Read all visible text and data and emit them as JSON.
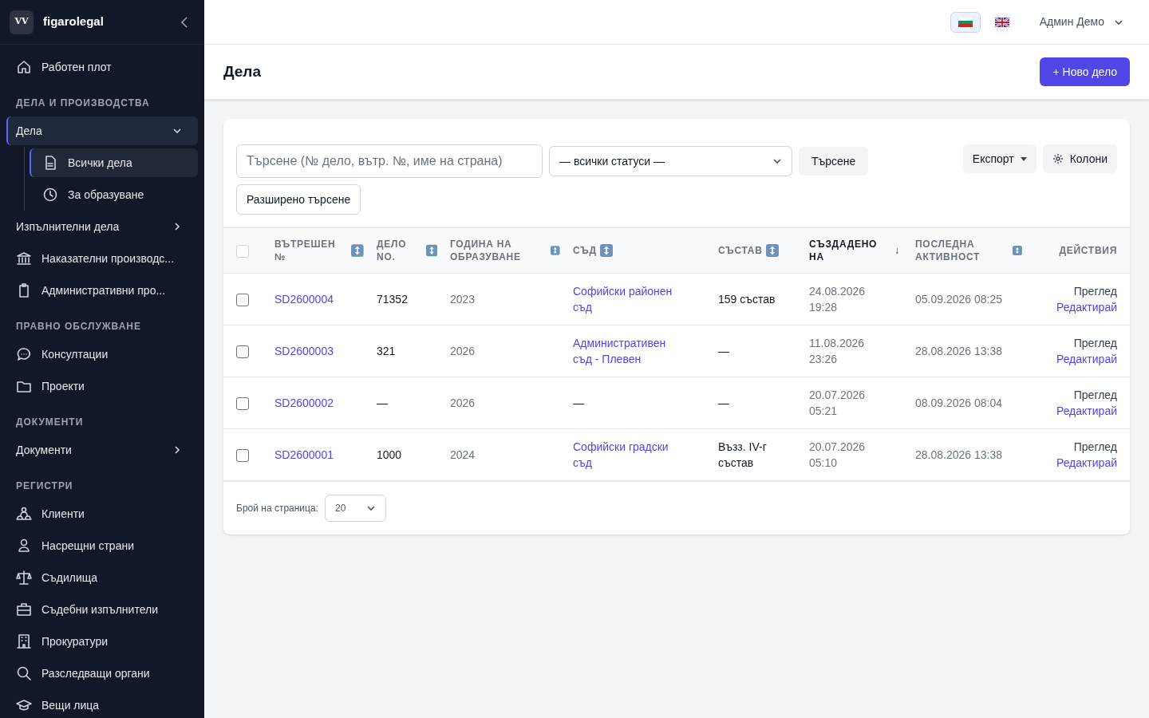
{
  "sidebar": {
    "brand": "figarolegal",
    "logo_text": "VV",
    "sections": [
      {
        "items": [
          {
            "label": "Работен плот",
            "kind": "link",
            "selected": false
          }
        ]
      },
      {
        "heading": "ДЕЛА И ПРОИЗВОДСТВА",
        "items": [
          {
            "label": "Дела",
            "kind": "group",
            "expanded": true,
            "selected": true,
            "children": [
              {
                "label": "Всички дела",
                "selected": true
              },
              {
                "label": "За образуване",
                "selected": false
              }
            ]
          },
          {
            "label": "Изпълнителни дела",
            "kind": "group",
            "expanded": false,
            "selected": false
          },
          {
            "label": "Наказателни производс...",
            "kind": "link",
            "selected": false
          },
          {
            "label": "Административни про...",
            "kind": "link",
            "selected": false
          }
        ]
      },
      {
        "heading": "ПРАВНО ОБСЛУЖВАНЕ",
        "items": [
          {
            "label": "Консултации",
            "kind": "link",
            "selected": false
          },
          {
            "label": "Проекти",
            "kind": "link",
            "selected": false
          }
        ]
      },
      {
        "heading": "ДОКУМЕНТИ",
        "items": [
          {
            "label": "Документи",
            "kind": "group",
            "expanded": false,
            "selected": false
          }
        ]
      },
      {
        "heading": "РЕГИСТРИ",
        "items": [
          {
            "label": "Клиенти",
            "kind": "link",
            "selected": false
          },
          {
            "label": "Насрещни страни",
            "kind": "link",
            "selected": false
          },
          {
            "label": "Съдилища",
            "kind": "link",
            "selected": false
          },
          {
            "label": "Съдебни изпълнители",
            "kind": "link",
            "selected": false
          },
          {
            "label": "Прокуратури",
            "kind": "link",
            "selected": false
          },
          {
            "label": "Разследващи органи",
            "kind": "link",
            "selected": false
          },
          {
            "label": "Вещи лица",
            "kind": "link",
            "selected": false
          }
        ]
      }
    ]
  },
  "top_bar": {
    "languages": [
      {
        "kind": "bg",
        "selected": true
      },
      {
        "kind": "en",
        "selected": false
      }
    ],
    "user": "Админ Демо"
  },
  "page": {
    "title": "Дела",
    "new_button": "+ Ново дело"
  },
  "filters": {
    "search_placeholder": "Търсене (№ дело, вътр. №, име на страна)",
    "status": "— всички статуси —",
    "search_button": "Търсене",
    "export_button": "Експорт",
    "columns_button": "Колони",
    "advanced_button": "Разширено търсене"
  },
  "table": {
    "select_all": {
      "checked": false
    },
    "columns": [
      {
        "label": "ВЪТРЕШЕН №",
        "sortable": true,
        "sorted": false
      },
      {
        "label": "ДЕЛО NO.",
        "sortable": true,
        "sorted": false
      },
      {
        "label": "ГОДИНА НА ОБРАЗУВАНЕ",
        "sortable": true,
        "sorted": false
      },
      {
        "label": "СЪД",
        "sortable": true,
        "sorted": false
      },
      {
        "label": "СЪСТАВ",
        "sortable": true,
        "sorted": false
      },
      {
        "label": "СЪЗДАДЕНО НА",
        "sortable": true,
        "sorted": true,
        "sort_mark": "↓"
      },
      {
        "label": "ПОСЛЕДНА АКТИВНОСТ",
        "sortable": true,
        "sorted": false
      },
      {
        "label": "ДЕЙСТВИЯ",
        "sortable": false,
        "sorted": false
      }
    ],
    "rows": [
      {
        "checked": false,
        "internal_no": "SD2600004",
        "case_no": "71352",
        "year": "2023",
        "court": "Софийски районен съд",
        "panel": "159 състав",
        "created": "24.08.2026 19:28",
        "last_activity": "05.09.2026 08:25",
        "view": "Преглед",
        "edit": "Редактирай"
      },
      {
        "checked": false,
        "internal_no": "SD2600003",
        "case_no": "321",
        "year": "2026",
        "court": "Административен съд - Плевен",
        "panel": "—",
        "created": "11.08.2026 23:26",
        "last_activity": "28.08.2026 13:38",
        "view": "Преглед",
        "edit": "Редактирай"
      },
      {
        "checked": false,
        "internal_no": "SD2600002",
        "case_no": "—",
        "year": "2026",
        "court": "—",
        "panel": "—",
        "created": "20.07.2026 05:21",
        "last_activity": "08.09.2026 08:04",
        "view": "Преглед",
        "edit": "Редактирай"
      },
      {
        "checked": false,
        "internal_no": "SD2600001",
        "case_no": "1000",
        "year": "2024",
        "court": "Софийски градски съд",
        "panel": "Възз. IV-г състав",
        "created": "20.07.2026 05:10",
        "last_activity": "28.08.2026 13:38",
        "view": "Преглед",
        "edit": "Редактирай"
      }
    ]
  },
  "pagination": {
    "label": "Брой на страница:",
    "per_page": "20"
  }
}
